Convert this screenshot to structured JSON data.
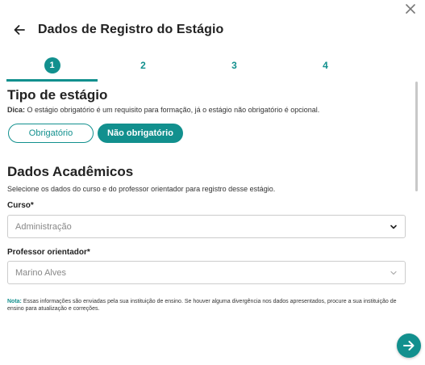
{
  "dialog": {
    "title": "Dados de Registro do Estágio",
    "close_label": "×"
  },
  "steps": [
    {
      "number": "1",
      "active": true
    },
    {
      "number": "2",
      "active": false
    },
    {
      "number": "3",
      "active": false
    },
    {
      "number": "4",
      "active": false
    }
  ],
  "tipo": {
    "title": "Tipo de estágio",
    "hint_bold": "Dica:",
    "hint_text": " O estágio obrigatório é um requisito para formação, já o estágio não obrigatório é opcional.",
    "option_obrigatorio": "Obrigatório",
    "option_nao_obrigatorio": "Não obrigatório",
    "selected": "Não obrigatório"
  },
  "academicos": {
    "title": "Dados Acadêmicos",
    "description": "Selecione os dados do curso e do professor orientador para registro desse estágio.",
    "curso_label": "Curso*",
    "curso_value": "Administração",
    "professor_label": "Professor orientador*",
    "professor_value": "Marino Alves"
  },
  "note": {
    "bold": "Nota:",
    "text": " Essas informações são enviadas pela sua instituição de ensino. Se houver alguma divergência nos dados apresentados, procure a sua instituição de ensino para atualização e correções."
  },
  "colors": {
    "accent": "#12908e",
    "text": "#222222",
    "border": "#cccccc"
  },
  "icons": {
    "close": "close-icon",
    "back": "arrow-left-icon",
    "next": "arrow-right-icon",
    "chevron": "chevron-down-icon"
  }
}
